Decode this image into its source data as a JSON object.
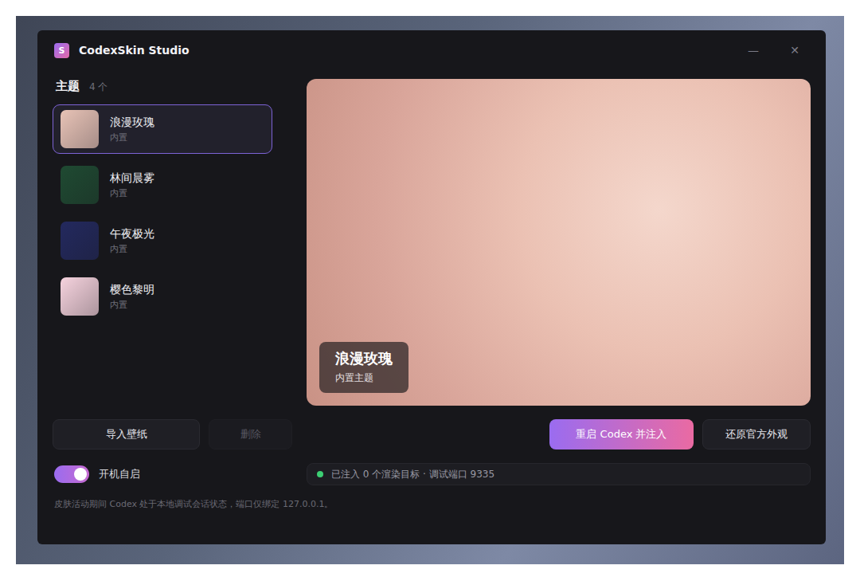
{
  "window": {
    "title": "CodexSkin Studio",
    "logo": "S",
    "controls": [
      "—",
      "✕"
    ]
  },
  "themes": {
    "title": "主题",
    "count": "4 个",
    "items": [
      {
        "name": "浪漫玫瑰",
        "source": "内置",
        "selected": true,
        "color": "#e8c3b6"
      },
      {
        "name": "林间晨雾",
        "source": "内置",
        "selected": false,
        "color": "#1f4a32"
      },
      {
        "name": "午夜极光",
        "source": "内置",
        "selected": false,
        "color": "#23295e"
      },
      {
        "name": "樱色黎明",
        "source": "内置",
        "selected": false,
        "color": "#f6d3de"
      }
    ]
  },
  "preview": {
    "name": "浪漫玫瑰",
    "caption": "内置主题"
  },
  "buttons": {
    "import": {
      "label": "导入壁纸",
      "disabled": false
    },
    "delete": {
      "label": "删除",
      "disabled": true
    },
    "inject": "重启 Codex 并注入",
    "restore": "还原官方外观"
  },
  "autostart": {
    "label": "开机自启",
    "on": true
  },
  "status": {
    "text": "已注入 0 个渲染目标 · 调试端口 9335",
    "color": "#3ccf73"
  },
  "note": "皮肤活动期间 Codex 处于本地调试会话状态，端口仅绑定 127.0.0.1。"
}
